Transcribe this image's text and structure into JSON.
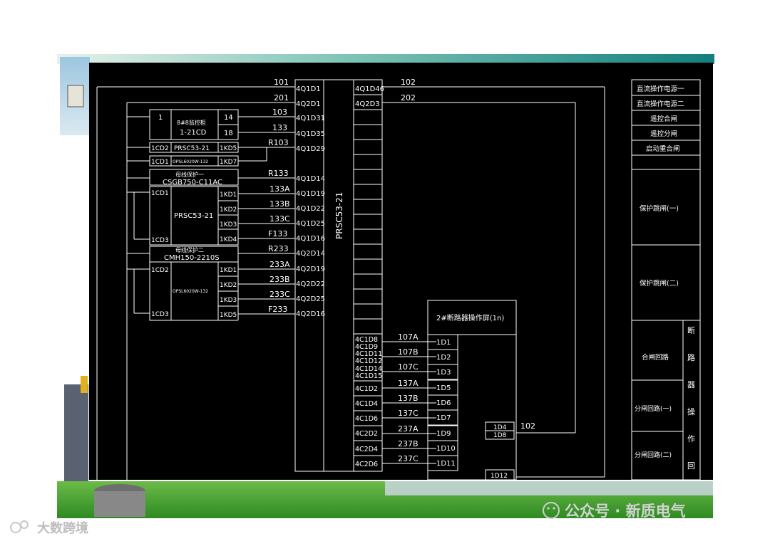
{
  "diagram": {
    "top_labels": [
      "101",
      "201",
      "102",
      "202"
    ],
    "left_boxes": {
      "box1_left_num": "1",
      "box1_right_nums": [
        "14",
        "18"
      ],
      "box1_title": "8#8监控柜",
      "box1_model": "1-21CD",
      "prsc_row": {
        "left": "1CD2",
        "name": "PRSC53-21",
        "right": "1KD5"
      },
      "opsl_row": {
        "left": "1CD1",
        "name": "OPSL6020W-132",
        "right": "1KD7"
      },
      "bus1_title": "母线保护一",
      "bus1_model": "CSGB750-C11AC",
      "prsc_block": {
        "left_top": "1CD1",
        "left_bottom": "1CD3",
        "name": "PRSC53-21",
        "rights": [
          "1KD1",
          "1KD2",
          "1KD3",
          "1KD4"
        ]
      },
      "bus2_title": "母线保护二",
      "bus2_model": "CMH150-2210S",
      "opsl_block": {
        "left_top": "1CD2",
        "left_bottom": "1CD3",
        "name": "OPSL6020W-132",
        "rights": [
          "1KD1",
          "1KD2",
          "1KD3",
          "1KD5"
        ]
      }
    },
    "wire_labels": [
      "103",
      "133",
      "R103",
      "R133",
      "133A",
      "133B",
      "133C",
      "F133",
      "R233",
      "233A",
      "233B",
      "233C",
      "F233"
    ],
    "center_terminals_left": [
      "4Q1D1",
      "4Q2D1",
      "4Q1D31",
      "4Q1D35",
      "4Q1D29",
      "4Q1D14",
      "4Q1D19",
      "4Q1D22",
      "4Q1D25",
      "4Q1D16",
      "4Q2D14",
      "4Q2D19",
      "4Q2D22",
      "4Q2D25",
      "4Q2D16"
    ],
    "center_terminals_right_top": [
      "4Q1D46",
      "4Q2D3"
    ],
    "center_device_name": "PRSC53-21",
    "center_terminals_right_bottom": [
      "4C1D8",
      "4C1D9",
      "4C1D11",
      "4C1D12",
      "4C1D14",
      "4C1D15",
      "4C1D2",
      "4C1D4",
      "4C1D6",
      "4C2D2",
      "4C2D4",
      "4C2D6"
    ],
    "lower_wire_labels": [
      "107A",
      "107B",
      "107C",
      "137A",
      "137B",
      "137C",
      "237A",
      "237B",
      "237C"
    ],
    "breaker_box": {
      "title": "2#断路器操作屏(1n)",
      "terminals": [
        "1D1",
        "1D2",
        "1D3",
        "1D5",
        "1D6",
        "1D7",
        "1D9",
        "1D10",
        "1D11"
      ],
      "side_top": "1D4",
      "side_bottom": "1D8",
      "bottom": "1D12",
      "side_wire": "102"
    },
    "right_panel": {
      "rows": [
        "直流操作电源一",
        "直流操作电源二",
        "遥控合闸",
        "遥控分闸",
        "启动重合闸",
        "",
        "保护跳闸(一)",
        "保护跳闸(二)",
        "合闸回路",
        "分闸回路(一)",
        "分闸回路(二)"
      ],
      "vertical_chars": [
        "断",
        "路",
        "器",
        "操",
        "作",
        "回"
      ]
    }
  },
  "footer": {
    "watermark_left": "大数跨境",
    "watermark_right": "公众号 · 新质电气"
  },
  "colors": {
    "diagram_bg": "#000000",
    "line": "#ffffff",
    "banner": "#1a8a86",
    "grass": "#3f9c2c"
  }
}
